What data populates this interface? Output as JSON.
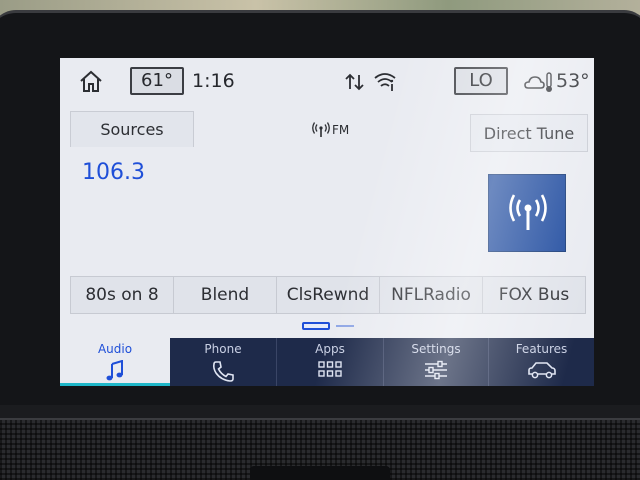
{
  "status": {
    "cabin_temp": "61°",
    "time": "1:16",
    "fan_level": "LO",
    "outside_temp": "53°"
  },
  "audio": {
    "sources_label": "Sources",
    "band": "FM",
    "direct_tune_label": "Direct Tune",
    "frequency": "106.3",
    "presets": [
      "80s on 8",
      "Blend",
      "ClsRewnd",
      "NFLRadio",
      "FOX Bus"
    ]
  },
  "nav": {
    "audio": "Audio",
    "phone": "Phone",
    "apps": "Apps",
    "settings": "Settings",
    "features": "Features"
  },
  "colors": {
    "accent_blue": "#1f4fd8",
    "nav_bg": "#1e2a4a",
    "signal_button": "#1f4b9f",
    "active_underline": "#1fb7c9"
  },
  "icons": [
    "home-icon",
    "data-transfer-icon",
    "wifi-icon",
    "partly-cloudy-icon",
    "thermometer-icon",
    "antenna-icon",
    "signal-icon",
    "music-note-icon",
    "phone-icon",
    "apps-grid-icon",
    "settings-sliders-icon",
    "car-icon"
  ]
}
